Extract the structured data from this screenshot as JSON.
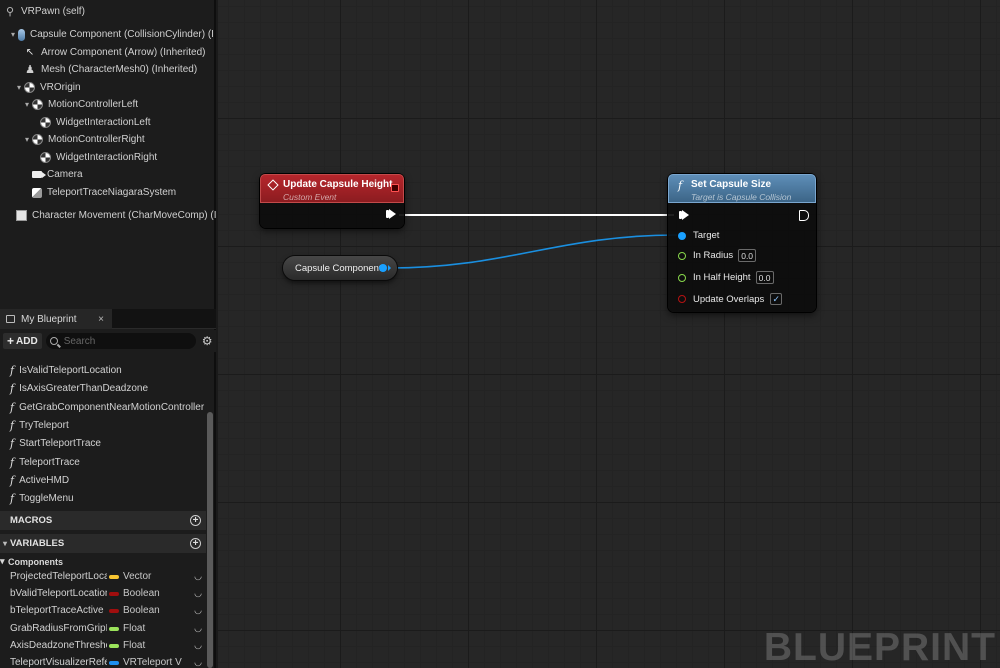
{
  "component_tree": [
    {
      "label": "VRPawn (self)",
      "icon": "pawn-icon"
    },
    {
      "label": "Capsule Component (CollisionCylinder) (I",
      "icon": "capsule-icon",
      "expander": "▾"
    },
    {
      "label": "Arrow Component (Arrow) (Inherited)",
      "icon": "arrow-icon"
    },
    {
      "label": "Mesh (CharacterMesh0) (Inherited)",
      "icon": "mesh-icon"
    },
    {
      "label": "VROrigin",
      "icon": "scene-icon",
      "expander": "▾"
    },
    {
      "label": "MotionControllerLeft",
      "icon": "scene-icon",
      "expander": "▾"
    },
    {
      "label": "WidgetInteractionLeft",
      "icon": "scene-icon"
    },
    {
      "label": "MotionControllerRight",
      "icon": "scene-icon",
      "expander": "▾"
    },
    {
      "label": "WidgetInteractionRight",
      "icon": "scene-icon"
    },
    {
      "label": "Camera",
      "icon": "camera-icon"
    },
    {
      "label": "TeleportTraceNiagaraSystem",
      "icon": "niagara-icon"
    },
    {
      "label": "Character Movement (CharMoveComp) (I",
      "icon": "movement-icon"
    }
  ],
  "my_blueprint": {
    "tab_label": "My Blueprint",
    "close_glyph": "×",
    "add_label": "ADD",
    "search_placeholder": "Search",
    "functions": [
      "IsValidTeleportLocation",
      "IsAxisGreaterThanDeadzone",
      "GetGrabComponentNearMotionController",
      "TryTeleport",
      "StartTeleportTrace",
      "TeleportTrace",
      "ActiveHMD",
      "ToggleMenu"
    ],
    "macros_label": "MACROS",
    "variables_label": "VARIABLES",
    "components_label": "Components",
    "variables": [
      {
        "name": "ProjectedTeleportLocati",
        "type": "Vector",
        "color": "#f7c531"
      },
      {
        "name": "bValidTeleportLocation",
        "type": "Boolean",
        "color": "#a00e0e"
      },
      {
        "name": "bTeleportTraceActive",
        "type": "Boolean",
        "color": "#a00e0e"
      },
      {
        "name": "GrabRadiusFromGripPo",
        "type": "Float",
        "color": "#9be35b"
      },
      {
        "name": "AxisDeadzoneThreshold",
        "type": "Float",
        "color": "#9be35b"
      },
      {
        "name": "TeleportVisualizerRefere",
        "type": "VRTeleport V",
        "color": "#1e8ff0"
      }
    ]
  },
  "graph": {
    "event_node": {
      "title": "Update Capsule Height",
      "subtitle": "Custom Event",
      "header_color": "#a51f24"
    },
    "component_node": {
      "label": "Capsule Component",
      "pin_color": "#19a0ff"
    },
    "function_node": {
      "title": "Set Capsule Size",
      "subtitle": "Target is Capsule Collision",
      "header_color": "#4e7ea8",
      "pins": {
        "target": "Target",
        "in_radius": "In Radius",
        "in_radius_value": "0.0",
        "in_half_height": "In Half Height",
        "in_half_height_value": "0.0",
        "update_overlaps": "Update Overlaps",
        "update_overlaps_checked": "✓"
      }
    },
    "watermark": "BLUEPRINT"
  }
}
